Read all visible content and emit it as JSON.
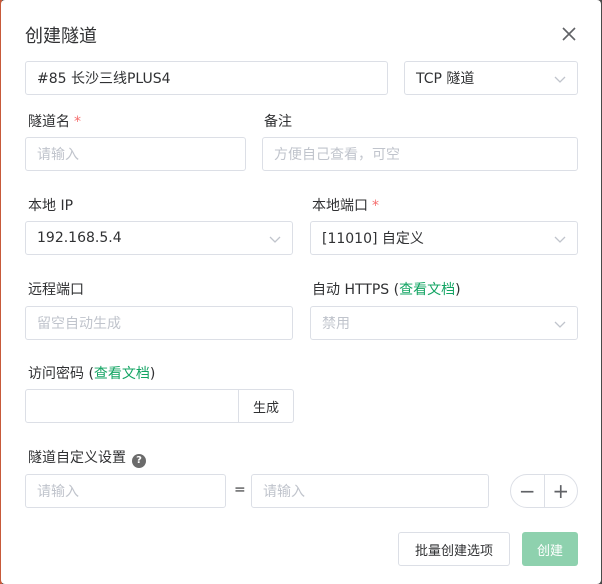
{
  "dialog": {
    "title": "创建隧道",
    "node_select": "#85 长沙三线PLUS4",
    "type_select": "TCP 隧道",
    "tunnel_name": {
      "label": "隧道名",
      "required_mark": "*",
      "placeholder": "请输入"
    },
    "remark": {
      "label": "备注",
      "placeholder": "方便自己查看，可空"
    },
    "local_ip": {
      "label": "本地 IP",
      "value": "192.168.5.4"
    },
    "local_port": {
      "label": "本地端口",
      "required_mark": "*",
      "value": "[11010] 自定义"
    },
    "remote_port": {
      "label": "远程端口",
      "placeholder": "留空自动生成"
    },
    "auto_https": {
      "label_prefix": "自动 HTTPS (",
      "link": "查看文档",
      "label_suffix": ")",
      "value": "禁用"
    },
    "access_password": {
      "label_prefix": "访问密码 (",
      "link": "查看文档",
      "label_suffix": ")",
      "value": "",
      "generate_label": "生成"
    },
    "custom_settings": {
      "label": "隧道自定义设置",
      "help_icon": "question-circle-icon",
      "key_placeholder": "请输入",
      "equals": "=",
      "value_placeholder": "请输入",
      "minus": "−",
      "plus": "+"
    },
    "batch_button": "批量创建选项",
    "create_button": "创建"
  },
  "colors": {
    "accent": "#13a463",
    "required": "#f56c6c",
    "create_disabled": "#8ed1ae"
  }
}
